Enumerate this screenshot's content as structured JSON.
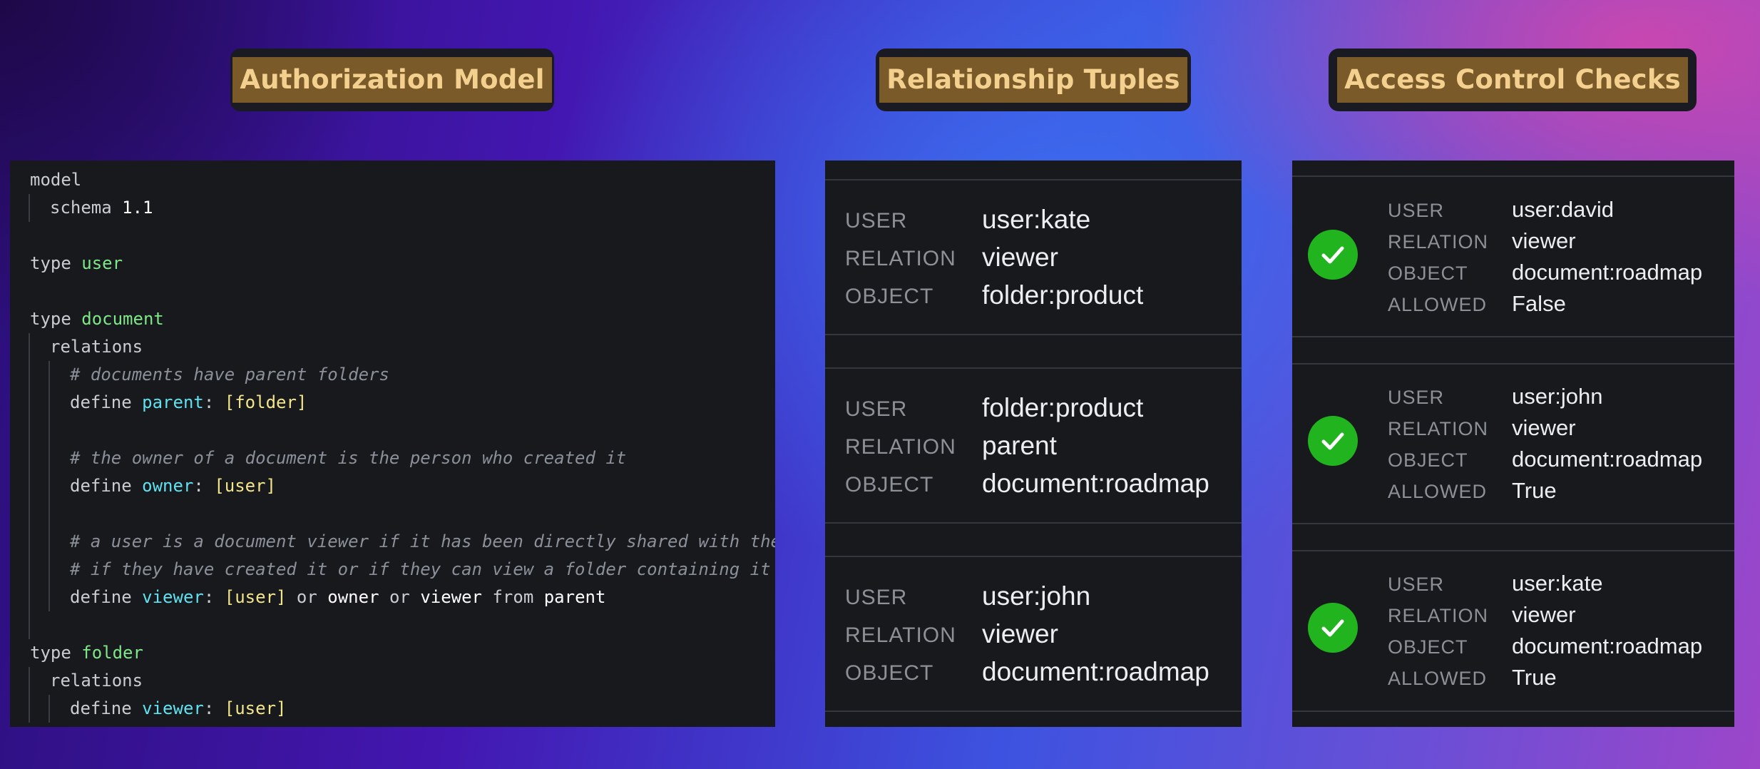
{
  "titles": {
    "model": "Authorization Model",
    "tuples": "Relationship Tuples",
    "checks": "Access Control Checks"
  },
  "code": {
    "lines": [
      {
        "indent": 0,
        "tokens": [
          {
            "t": "model",
            "c": "plain"
          }
        ]
      },
      {
        "indent": 1,
        "tokens": [
          {
            "t": "schema ",
            "c": "plain"
          },
          {
            "t": "1.1",
            "c": "white"
          }
        ]
      },
      {
        "indent": 0,
        "tokens": []
      },
      {
        "indent": 0,
        "tokens": [
          {
            "t": "type ",
            "c": "plain"
          },
          {
            "t": "user",
            "c": "type"
          }
        ]
      },
      {
        "indent": 0,
        "tokens": []
      },
      {
        "indent": 0,
        "tokens": [
          {
            "t": "type ",
            "c": "plain"
          },
          {
            "t": "document",
            "c": "type"
          }
        ]
      },
      {
        "indent": 1,
        "tokens": [
          {
            "t": "relations",
            "c": "plain"
          }
        ]
      },
      {
        "indent": 2,
        "tokens": [
          {
            "t": "# documents have parent folders",
            "c": "comment"
          }
        ]
      },
      {
        "indent": 2,
        "tokens": [
          {
            "t": "define ",
            "c": "plain"
          },
          {
            "t": "parent",
            "c": "rel"
          },
          {
            "t": ": ",
            "c": "plain"
          },
          {
            "t": "[folder]",
            "c": "bracket"
          }
        ]
      },
      {
        "indent": 2,
        "tokens": []
      },
      {
        "indent": 2,
        "tokens": [
          {
            "t": "# the owner of a document is the person who created it",
            "c": "comment"
          }
        ]
      },
      {
        "indent": 2,
        "tokens": [
          {
            "t": "define ",
            "c": "plain"
          },
          {
            "t": "owner",
            "c": "rel"
          },
          {
            "t": ": ",
            "c": "plain"
          },
          {
            "t": "[user]",
            "c": "bracket"
          }
        ]
      },
      {
        "indent": 2,
        "tokens": []
      },
      {
        "indent": 2,
        "tokens": [
          {
            "t": "# a user is a document viewer if it has been directly shared with them",
            "c": "comment"
          }
        ]
      },
      {
        "indent": 2,
        "tokens": [
          {
            "t": "# if they have created it or if they can view a folder containing it",
            "c": "comment"
          }
        ]
      },
      {
        "indent": 2,
        "tokens": [
          {
            "t": "define ",
            "c": "plain"
          },
          {
            "t": "viewer",
            "c": "rel"
          },
          {
            "t": ": ",
            "c": "plain"
          },
          {
            "t": "[user]",
            "c": "bracket"
          },
          {
            "t": " or ",
            "c": "plain"
          },
          {
            "t": "owner",
            "c": "white"
          },
          {
            "t": " or ",
            "c": "plain"
          },
          {
            "t": "viewer",
            "c": "white"
          },
          {
            "t": " from ",
            "c": "plain"
          },
          {
            "t": "parent",
            "c": "white"
          }
        ]
      },
      {
        "indent": 1,
        "tokens": []
      },
      {
        "indent": 0,
        "tokens": [
          {
            "t": "type ",
            "c": "plain"
          },
          {
            "t": "folder",
            "c": "type"
          }
        ]
      },
      {
        "indent": 1,
        "tokens": [
          {
            "t": "relations",
            "c": "plain"
          }
        ]
      },
      {
        "indent": 2,
        "tokens": [
          {
            "t": "define ",
            "c": "plain"
          },
          {
            "t": "viewer",
            "c": "rel"
          },
          {
            "t": ": ",
            "c": "plain"
          },
          {
            "t": "[user]",
            "c": "bracket"
          }
        ]
      }
    ]
  },
  "labels": {
    "user": "USER",
    "relation": "RELATION",
    "object": "OBJECT",
    "allowed": "ALLOWED"
  },
  "tuples": [
    {
      "user": "user:kate",
      "relation": "viewer",
      "object": "folder:product"
    },
    {
      "user": "folder:product",
      "relation": "parent",
      "object": "document:roadmap"
    },
    {
      "user": "user:john",
      "relation": "viewer",
      "object": "document:roadmap"
    }
  ],
  "checks": [
    {
      "user": "user:david",
      "relation": "viewer",
      "object": "document:roadmap",
      "allowed": "False",
      "status_icon": "check-circle-icon",
      "icon_color": "#21b41f"
    },
    {
      "user": "user:john",
      "relation": "viewer",
      "object": "document:roadmap",
      "allowed": "True",
      "status_icon": "check-circle-icon",
      "icon_color": "#21b41f"
    },
    {
      "user": "user:kate",
      "relation": "viewer",
      "object": "document:roadmap",
      "allowed": "True",
      "status_icon": "check-circle-icon",
      "icon_color": "#21b41f"
    }
  ]
}
